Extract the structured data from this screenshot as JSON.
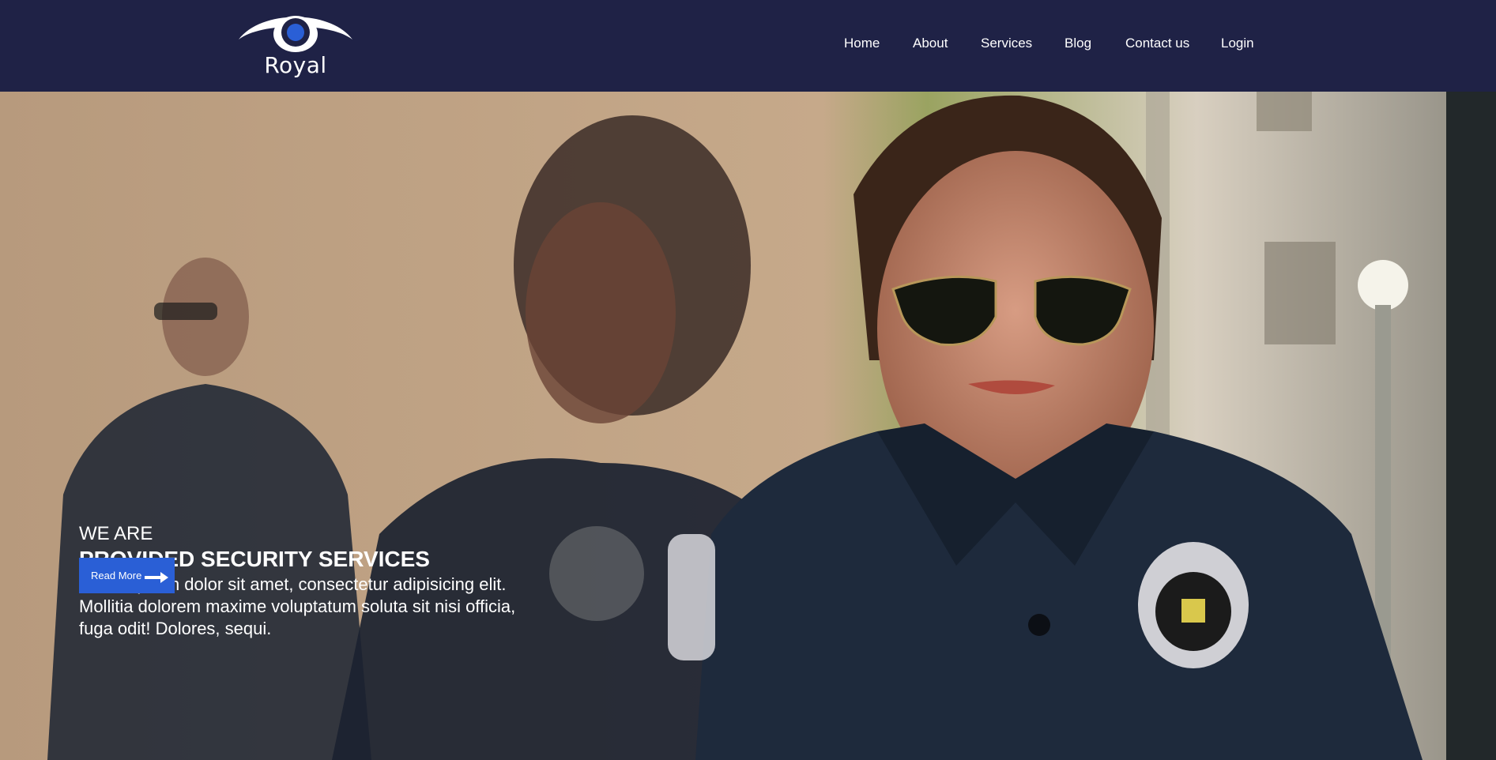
{
  "brand": {
    "name": "Royal",
    "logo_icon": "eye-icon",
    "pupil_color": "#2a5fd6"
  },
  "nav": {
    "items": [
      {
        "label": "Home"
      },
      {
        "label": "About"
      },
      {
        "label": "Services"
      },
      {
        "label": "Blog"
      },
      {
        "label": "Contact us"
      },
      {
        "label": "Login"
      }
    ]
  },
  "hero": {
    "eyebrow": "WE ARE",
    "headline": "PROVIDED SECURITY SERVICES",
    "description": "Lorem ipsum dolor sit amet, consectetur adipisicing elit. Mollitia dolorem maxime voluptatum soluta sit nisi officia, fuga odit! Dolores, sequi.",
    "cta_label": "Read More",
    "cta_icon": "arrow-right-icon",
    "background": "photo of security officers in uniform"
  },
  "colors": {
    "header_bg": "#1f2246",
    "accent": "#2a5fd6",
    "text": "#ffffff"
  }
}
